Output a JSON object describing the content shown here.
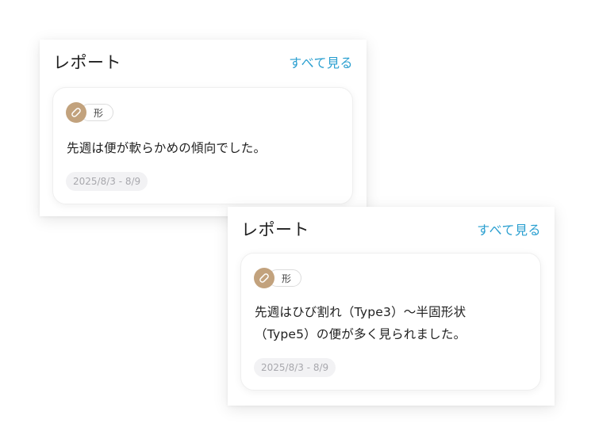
{
  "reports": [
    {
      "title": "レポート",
      "see_all": "すべて見る",
      "card": {
        "icon": "bandage-icon",
        "tag": "形",
        "text": "先週は便が軟らかめの傾向でした。",
        "date_range": "2025/8/3 - 8/9"
      }
    },
    {
      "title": "レポート",
      "see_all": "すべて見る",
      "card": {
        "icon": "bandage-icon",
        "tag": "形",
        "text_lines": [
          "先週はひび割れ（Type3）〜半固形状",
          "（Type5）の便が多く見られました。"
        ],
        "date_range": "2025/8/3 - 8/9"
      }
    }
  ],
  "colors": {
    "accent_link": "#2a9fd0",
    "tag_icon_bg": "#c2a27d",
    "date_badge_bg": "#f2f2f4",
    "date_text": "#a8a8ad"
  }
}
